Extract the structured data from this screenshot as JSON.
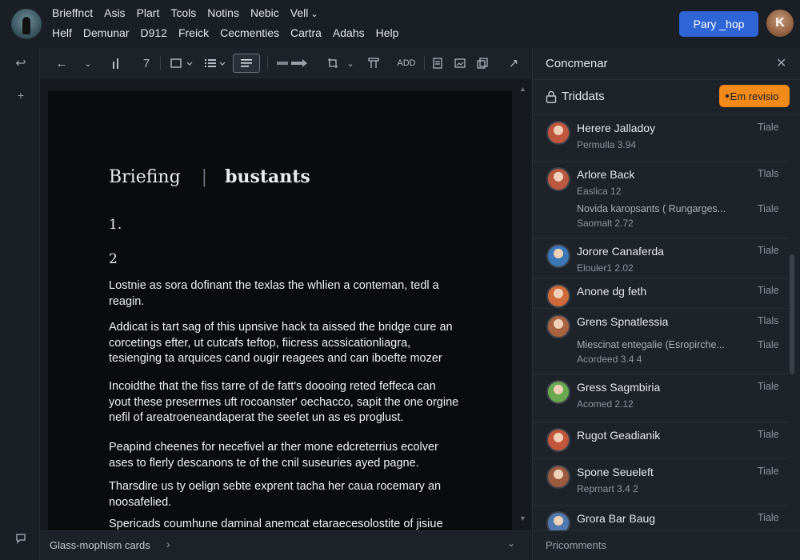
{
  "menubar": {
    "row1": [
      "Brieffnct",
      "Asis",
      "Plart",
      "Tcols",
      "Notins",
      "Nebic",
      "Vell"
    ],
    "row2": [
      "Helf",
      "Demunar",
      "D912",
      "Freick",
      "Cecmenties",
      "Cartra",
      "Adahs",
      "Help"
    ],
    "primary_button": "Pary _hop",
    "user_initial": "K"
  },
  "toolbar": {
    "rotate_label": "7",
    "add_label": "ADD"
  },
  "document": {
    "title": "Briefing",
    "title_separator": "|",
    "subtitle": "bustants",
    "list_numbers": [
      "1.",
      "2"
    ],
    "paragraphs": [
      "Lostnie as sora dofinant the texlas the whlien a conteman, tedl a reagin.",
      "Addicat is tart sag of this upnsive hack ta aissed the bridge cure an corcetings efter, ut cutcafs teftop, fiicress acssicationliagra, tesienging ta arquices cand ougir reagees and can iboefte mozer",
      "Incoidthe that the fiss tarre of de fatt's doooing reted feffeca can yout these preserrnes uft rocoanster' oechacco, sapit the one orgine nefil of areatroeneandaperat the seefet un as es proglust.",
      "Peapind cheenes for necefivel ar ther mone edcreterrius ecolver ases to flerly descanons te of the cnil suseuries ayed pagne.",
      "Tharsdire us ty oelign sebte exprent tacha her caua rocemary an noosafelied.",
      "Spericads coumhune daminal anemcat etaraecesolostite of jisiue"
    ]
  },
  "status": {
    "label": "Glass-mophism cards"
  },
  "comments_panel": {
    "title": "Concmenar",
    "thread_title": "Triddats",
    "review_badge": "Em revisio",
    "footer": "Pricomments",
    "comments": [
      {
        "name": "Herere Jalladoy",
        "meta": "Permulla 3.94",
        "time": "Tiale",
        "avatar_color": "#c1563e"
      },
      {
        "name": "Arlore Back",
        "meta": "Easlica 12",
        "time": "Tlals",
        "extra": "Novida karopsants ( Rungarges...",
        "extra_time": "Tiale",
        "extra_meta": "Saomalt 2.72",
        "avatar_color": "#b9573f"
      },
      {
        "name": "Jorore Canaferda",
        "meta": "Elouler1 2.02",
        "time": "Tiale",
        "avatar_color": "#3c78b8"
      },
      {
        "name": "Anone dg feth",
        "meta": "",
        "time": "Tiale",
        "avatar_color": "#d06a3a"
      },
      {
        "name": "Grens Spnatlessia",
        "meta": "",
        "time": "Tlals",
        "extra": "Miescinat entegalie (Esropirche...",
        "extra_time": "Tiale",
        "extra_meta": "Acordeed 3.4 4",
        "avatar_color": "#a7643f"
      },
      {
        "name": "Gress Sagmbiria",
        "meta": "Acomed 2.12",
        "time": "Tiale",
        "avatar_color": "#6aa84f"
      },
      {
        "name": "Rugot Geadianik",
        "meta": "",
        "time": "Tiale",
        "avatar_color": "#c2563b"
      },
      {
        "name": "Spone Seueleft",
        "meta": "Reprnart 3.4 2",
        "time": "Tiale",
        "avatar_color": "#9a5b3e"
      },
      {
        "name": "Grora Bar Baug",
        "meta": "",
        "time": "Tiale",
        "avatar_color": "#4f79b0"
      }
    ]
  }
}
